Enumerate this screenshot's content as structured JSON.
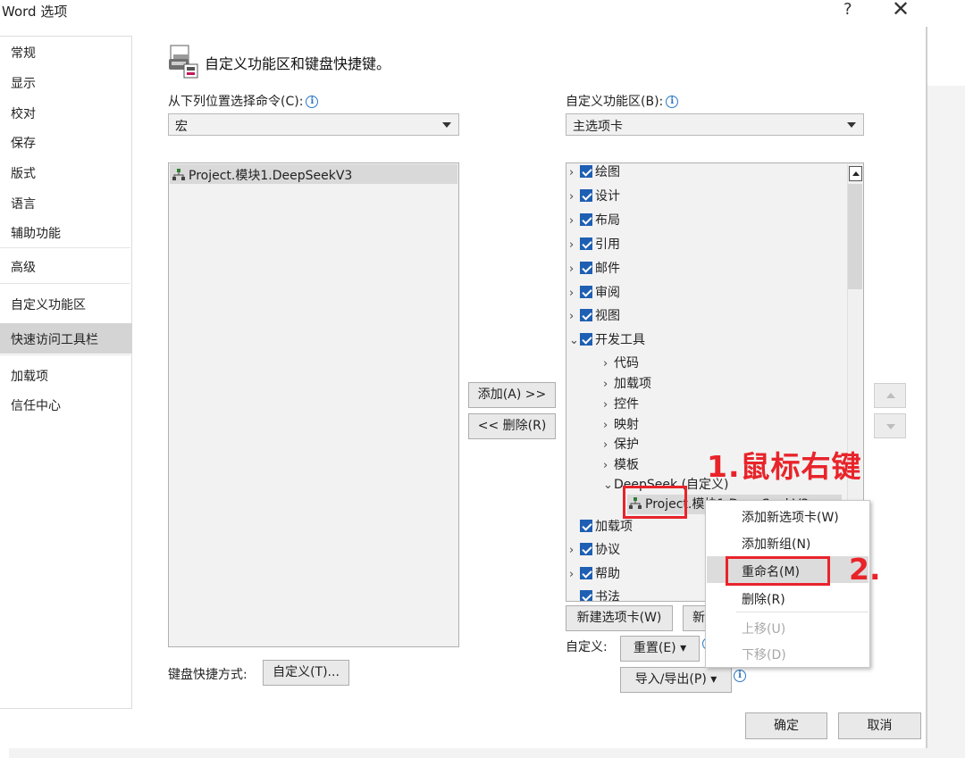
{
  "window": {
    "title": "Word 选项",
    "help_label": "?",
    "close_label": "✕"
  },
  "sidebar": {
    "items": [
      {
        "label": "常规"
      },
      {
        "label": "显示"
      },
      {
        "label": "校对"
      },
      {
        "label": "保存"
      },
      {
        "label": "版式"
      },
      {
        "label": "语言"
      },
      {
        "label": "辅助功能"
      },
      {
        "label": "高级"
      },
      {
        "label": "自定义功能区",
        "selected": true
      },
      {
        "label": "快速访问工具栏"
      },
      {
        "label": "加载项"
      },
      {
        "label": "信任中心"
      }
    ]
  },
  "header": {
    "title": "自定义功能区和键盘快捷键。",
    "icon": "customize-ribbon-icon"
  },
  "left_panel": {
    "choose_label": "从下列位置选择命令(C):",
    "choose_value": "宏",
    "commands": [
      "Project.模块1.DeepSeekV3"
    ]
  },
  "right_panel": {
    "customize_label": "自定义功能区(B):",
    "customize_value": "主选项卡",
    "tree": [
      {
        "label": "绘图",
        "checked": true,
        "expanded": false,
        "level": 0
      },
      {
        "label": "设计",
        "checked": true,
        "expanded": false,
        "level": 0
      },
      {
        "label": "布局",
        "checked": true,
        "expanded": false,
        "level": 0
      },
      {
        "label": "引用",
        "checked": true,
        "expanded": false,
        "level": 0
      },
      {
        "label": "邮件",
        "checked": true,
        "expanded": false,
        "level": 0
      },
      {
        "label": "审阅",
        "checked": true,
        "expanded": false,
        "level": 0
      },
      {
        "label": "视图",
        "checked": true,
        "expanded": false,
        "level": 0
      },
      {
        "label": "开发工具",
        "checked": true,
        "expanded": true,
        "level": 0
      },
      {
        "label": "代码",
        "level": 1
      },
      {
        "label": "加载项",
        "level": 1
      },
      {
        "label": "控件",
        "level": 1
      },
      {
        "label": "映射",
        "level": 1
      },
      {
        "label": "保护",
        "level": 1
      },
      {
        "label": "模板",
        "level": 1
      },
      {
        "label": "DeepSeek (自定义)",
        "level": 1,
        "expanded": true
      },
      {
        "label": "Project.模块1.DeepSeekV3",
        "level": 2,
        "selected": true
      },
      {
        "label": "加载项",
        "checked": true,
        "level": 0
      },
      {
        "label": "协议",
        "checked": true,
        "expanded": false,
        "level": 0
      },
      {
        "label": "帮助",
        "checked": true,
        "expanded": false,
        "level": 0
      },
      {
        "label": "书法",
        "checked": true,
        "level": 0
      }
    ],
    "new_tab_button": "新建选项卡(W)",
    "new_group_button_partial": "新",
    "customizations_label": "自定义:",
    "reset_button": "重置(E) ▾",
    "import_export_button": "导入/导出(P) ▾"
  },
  "middle": {
    "add_button": "添加(A) >>",
    "remove_button": "<< 删除(R)"
  },
  "keyboard": {
    "label": "键盘快捷方式:",
    "customize_button": "自定义(T)..."
  },
  "context_menu": {
    "items": [
      {
        "label": "添加新选项卡(W)",
        "enabled": true
      },
      {
        "label": "添加新组(N)",
        "enabled": true
      },
      {
        "label": "重命名(M)",
        "enabled": true,
        "highlighted": true
      },
      {
        "label": "删除(R)",
        "enabled": true
      },
      {
        "label": "上移(U)",
        "enabled": false
      },
      {
        "label": "下移(D)",
        "enabled": false
      }
    ]
  },
  "annotations": {
    "step1": "1.鼠标右键",
    "step2": "2."
  },
  "footer": {
    "ok_button": "确定",
    "cancel_button": "取消"
  },
  "colors": {
    "checkbox": "#1f5fb3",
    "annotation_red": "#e8242a",
    "selection": "#d4d4d4"
  }
}
